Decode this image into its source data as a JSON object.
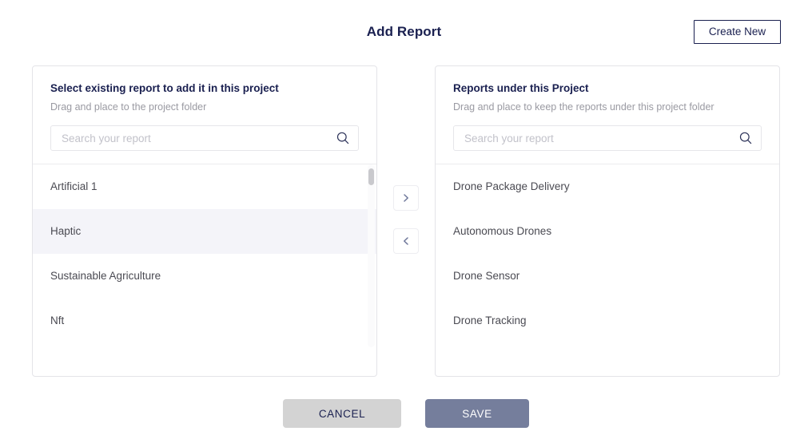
{
  "header": {
    "title": "Add Report",
    "create_new_label": "Create New"
  },
  "left_panel": {
    "title": "Select existing report to add it in this project",
    "subtitle": "Drag and place to the project folder",
    "search": {
      "placeholder": "Search your report",
      "value": "",
      "icon": "search-icon"
    },
    "items": [
      {
        "label": "Artificial 1",
        "selected": false
      },
      {
        "label": "Haptic",
        "selected": true
      },
      {
        "label": "Sustainable Agriculture",
        "selected": false
      },
      {
        "label": "Nft",
        "selected": false
      }
    ]
  },
  "transfer": {
    "move_right_icon": "chevron-right-icon",
    "move_left_icon": "chevron-left-icon"
  },
  "right_panel": {
    "title": "Reports under this Project",
    "subtitle": "Drag and place to keep the reports under this project folder",
    "search": {
      "placeholder": "Search your report",
      "value": "",
      "icon": "search-icon"
    },
    "items": [
      {
        "label": "Drone Package Delivery",
        "selected": false
      },
      {
        "label": "Autonomous Drones",
        "selected": false
      },
      {
        "label": "Drone Sensor",
        "selected": false
      },
      {
        "label": "Drone Tracking",
        "selected": false
      }
    ]
  },
  "footer": {
    "cancel_label": "CANCEL",
    "save_label": "SAVE"
  },
  "colors": {
    "title": "#1a2050",
    "save_button": "#757e9c",
    "cancel_button": "#d3d3d3",
    "selected_row": "#f4f4f9",
    "panel_border": "#e4e4e8",
    "subtitle_text": "#9a9aa2"
  }
}
